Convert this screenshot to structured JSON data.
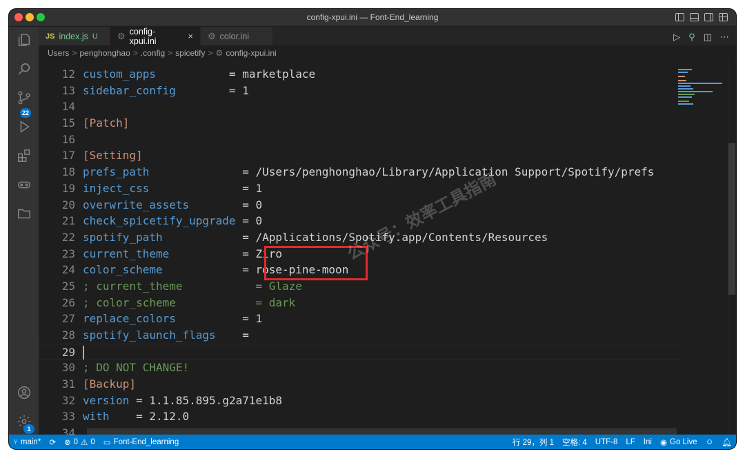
{
  "window": {
    "title": "config-xpui.ini — Font-End_learning"
  },
  "activity": {
    "scm_badge": "22",
    "settings_badge": "1"
  },
  "tabs": [
    {
      "icon": "JS",
      "label": "index.js",
      "suffix": "U"
    },
    {
      "label": "config-xpui.ini",
      "close": "×"
    },
    {
      "label": "color.ini"
    }
  ],
  "breadcrumb": [
    "Users",
    "penghonghao",
    ".config",
    "spicetify",
    "config-xpui.ini"
  ],
  "breadcrumb_sep": ">",
  "code": {
    "lines": [
      {
        "n": "12",
        "key": "custom_apps",
        "pad": "           ",
        "eq": "=",
        "val": " marketplace"
      },
      {
        "n": "13",
        "key": "sidebar_config",
        "pad": "        ",
        "eq": "=",
        "val": " 1"
      },
      {
        "n": "14"
      },
      {
        "n": "15",
        "section": "[Patch]"
      },
      {
        "n": "16"
      },
      {
        "n": "17",
        "section": "[Setting]"
      },
      {
        "n": "18",
        "key": "prefs_path",
        "pad": "              ",
        "eq": "=",
        "val": " /Users/penghonghao/Library/Application Support/Spotify/prefs"
      },
      {
        "n": "19",
        "key": "inject_css",
        "pad": "              ",
        "eq": "=",
        "val": " 1"
      },
      {
        "n": "20",
        "key": "overwrite_assets",
        "pad": "        ",
        "eq": "=",
        "val": " 0"
      },
      {
        "n": "21",
        "key": "check_spicetify_upgrade",
        "pad": " ",
        "eq": "=",
        "val": " 0"
      },
      {
        "n": "22",
        "key": "spotify_path",
        "pad": "            ",
        "eq": "=",
        "val": " /Applications/Spotify.app/Contents/Resources"
      },
      {
        "n": "23",
        "key": "current_theme",
        "pad": "           ",
        "eq": "=",
        "val": " Ziro"
      },
      {
        "n": "24",
        "key": "color_scheme",
        "pad": "            ",
        "eq": "=",
        "val": " rose-pine-moon"
      },
      {
        "n": "25",
        "comment": "; current_theme           = Glaze"
      },
      {
        "n": "26",
        "comment": "; color_scheme            = dark"
      },
      {
        "n": "27",
        "key": "replace_colors",
        "pad": "          ",
        "eq": "=",
        "val": " 1"
      },
      {
        "n": "28",
        "key": "spotify_launch_flags",
        "pad": "    ",
        "eq": "=",
        "val": ""
      },
      {
        "n": "29",
        "current": true
      },
      {
        "n": "30",
        "comment": "; DO NOT CHANGE!"
      },
      {
        "n": "31",
        "section": "[Backup]"
      },
      {
        "n": "32",
        "key": "version",
        "pad": " ",
        "eq": "=",
        "val": " 1.1.85.895.g2a71e1b8"
      },
      {
        "n": "33",
        "key": "with",
        "pad": "    ",
        "eq": "=",
        "val": " 2.12.0"
      },
      {
        "n": "34"
      }
    ]
  },
  "watermark": "公众号：效率工具指南",
  "statusbar": {
    "branch": "main*",
    "errors": "0",
    "warnings": "0",
    "folder": "Font-End_learning",
    "position": "行 29，列 1",
    "spaces": "空格: 4",
    "encoding": "UTF-8",
    "eol": "LF",
    "language": "Ini",
    "golive": "Go Live"
  },
  "colors": {
    "accent": "#007acc",
    "highlight_box": "#e02b2b",
    "key": "#569cd6",
    "comment": "#6a9955",
    "section": "#ce9178"
  }
}
